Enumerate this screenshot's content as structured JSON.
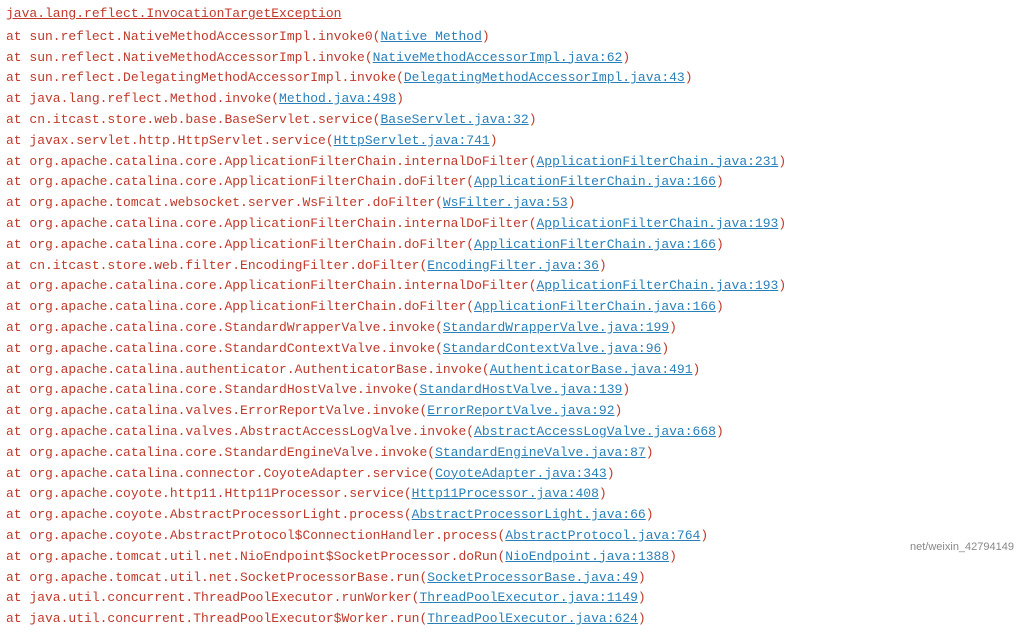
{
  "title": "java_lang_reflect_InvocationTargetException",
  "exception": {
    "name": "java.lang.reflect.InvocationTargetException"
  },
  "stack_lines": [
    {
      "prefix": "    at ",
      "method": "sun.reflect.NativeMethodAccessorImpl.invoke0(",
      "link_text": "Native Method",
      "link": "Native Method",
      "suffix": ")"
    },
    {
      "prefix": "    at ",
      "method": "sun.reflect.NativeMethodAccessorImpl.invoke(",
      "link_text": "NativeMethodAccessorImpl.java:62",
      "link": "NativeMethodAccessorImpl.java:62",
      "suffix": ")"
    },
    {
      "prefix": "    at ",
      "method": "sun.reflect.DelegatingMethodAccessorImpl.invoke(",
      "link_text": "DelegatingMethodAccessorImpl.java:43",
      "link": "DelegatingMethodAccessorImpl.java:43",
      "suffix": ")"
    },
    {
      "prefix": "    at ",
      "method": "java.lang.reflect.Method.invoke(",
      "link_text": "Method.java:498",
      "link": "Method.java:498",
      "suffix": ")"
    },
    {
      "prefix": "    at ",
      "method": "cn.itcast.store.web.base.BaseServlet.service(",
      "link_text": "BaseServlet.java:32",
      "link": "BaseServlet.java:32",
      "suffix": ")"
    },
    {
      "prefix": "    at ",
      "method": "javax.servlet.http.HttpServlet.service(",
      "link_text": "HttpServlet.java:741",
      "link": "HttpServlet.java:741",
      "suffix": ")"
    },
    {
      "prefix": "    at ",
      "method": "org.apache.catalina.core.ApplicationFilterChain.internalDoFilter(",
      "link_text": "ApplicationFilterChain.java:231",
      "link": "ApplicationFilterChain.java:231",
      "suffix": ")"
    },
    {
      "prefix": "    at ",
      "method": "org.apache.catalina.core.ApplicationFilterChain.doFilter(",
      "link_text": "ApplicationFilterChain.java:166",
      "link": "ApplicationFilterChain.java:166",
      "suffix": ")"
    },
    {
      "prefix": "    at ",
      "method": "org.apache.tomcat.websocket.server.WsFilter.doFilter(",
      "link_text": "WsFilter.java:53",
      "link": "WsFilter.java:53",
      "suffix": ")"
    },
    {
      "prefix": "    at ",
      "method": "org.apache.catalina.core.ApplicationFilterChain.internalDoFilter(",
      "link_text": "ApplicationFilterChain.java:193",
      "link": "ApplicationFilterChain.java:193",
      "suffix": ")"
    },
    {
      "prefix": "    at ",
      "method": "org.apache.catalina.core.ApplicationFilterChain.doFilter(",
      "link_text": "ApplicationFilterChain.java:166",
      "link": "ApplicationFilterChain.java:166",
      "suffix": ")"
    },
    {
      "prefix": "    at ",
      "method": "cn.itcast.store.web.filter.EncodingFilter.doFilter(",
      "link_text": "EncodingFilter.java:36",
      "link": "EncodingFilter.java:36",
      "suffix": ")"
    },
    {
      "prefix": "    at ",
      "method": "org.apache.catalina.core.ApplicationFilterChain.internalDoFilter(",
      "link_text": "ApplicationFilterChain.java:193",
      "link": "ApplicationFilterChain.java:193",
      "suffix": ")"
    },
    {
      "prefix": "    at ",
      "method": "org.apache.catalina.core.ApplicationFilterChain.doFilter(",
      "link_text": "ApplicationFilterChain.java:166",
      "link": "ApplicationFilterChain.java:166",
      "suffix": ")"
    },
    {
      "prefix": "    at ",
      "method": "org.apache.catalina.core.StandardWrapperValve.invoke(",
      "link_text": "StandardWrapperValve.java:199",
      "link": "StandardWrapperValve.java:199",
      "suffix": ")"
    },
    {
      "prefix": "    at ",
      "method": "org.apache.catalina.core.StandardContextValve.invoke(",
      "link_text": "StandardContextValve.java:96",
      "link": "StandardContextValve.java:96",
      "suffix": ")"
    },
    {
      "prefix": "    at ",
      "method": "org.apache.catalina.authenticator.AuthenticatorBase.invoke(",
      "link_text": "AuthenticatorBase.java:491",
      "link": "AuthenticatorBase.java:491",
      "suffix": ")"
    },
    {
      "prefix": "    at ",
      "method": "org.apache.catalina.core.StandardHostValve.invoke(",
      "link_text": "StandardHostValve.java:139",
      "link": "StandardHostValve.java:139",
      "suffix": ")"
    },
    {
      "prefix": "    at ",
      "method": "org.apache.catalina.valves.ErrorReportValve.invoke(",
      "link_text": "ErrorReportValve.java:92",
      "link": "ErrorReportValve.java:92",
      "suffix": ")"
    },
    {
      "prefix": "    at ",
      "method": "org.apache.catalina.valves.AbstractAccessLogValve.invoke(",
      "link_text": "AbstractAccessLogValve.java:668",
      "link": "AbstractAccessLogValve.java:668",
      "suffix": ")"
    },
    {
      "prefix": "    at ",
      "method": "org.apache.catalina.core.StandardEngineValve.invoke(",
      "link_text": "StandardEngineValve.java:87",
      "link": "StandardEngineValve.java:87",
      "suffix": ")"
    },
    {
      "prefix": "    at ",
      "method": "org.apache.catalina.connector.CoyoteAdapter.service(",
      "link_text": "CoyoteAdapter.java:343",
      "link": "CoyoteAdapter.java:343",
      "suffix": ")"
    },
    {
      "prefix": "    at ",
      "method": "org.apache.coyote.http11.Http11Processor.service(",
      "link_text": "Http11Processor.java:408",
      "link": "Http11Processor.java:408",
      "suffix": ")"
    },
    {
      "prefix": "    at ",
      "method": "org.apache.coyote.AbstractProcessorLight.process(",
      "link_text": "AbstractProcessorLight.java:66",
      "link": "AbstractProcessorLight.java:66",
      "suffix": ")"
    },
    {
      "prefix": "    at ",
      "method": "org.apache.coyote.AbstractProtocol$ConnectionHandler.process(",
      "link_text": "AbstractProtocol.java:764",
      "link": "AbstractProtocol.java:764",
      "suffix": ")"
    },
    {
      "prefix": "    at ",
      "method": "org.apache.tomcat.util.net.NioEndpoint$SocketProcessor.doRun(",
      "link_text": "NioEndpoint.java:1388",
      "link": "NioEndpoint.java:1388",
      "suffix": ")"
    },
    {
      "prefix": "    at ",
      "method": "org.apache.tomcat.util.net.SocketProcessorBase.run(",
      "link_text": "SocketProcessorBase.java:49",
      "link": "SocketProcessorBase.java:49",
      "suffix": ")"
    },
    {
      "prefix": "    at ",
      "method": "java.util.concurrent.ThreadPoolExecutor.runWorker(",
      "link_text": "ThreadPoolExecutor.java:1149",
      "link": "ThreadPoolExecutor.java:1149",
      "suffix": ")"
    },
    {
      "prefix": "    at ",
      "method": "java.util.concurrent.ThreadPoolExecutor$Worker.run(",
      "link_text": "ThreadPoolExecutor.java:624",
      "link": "ThreadPoolExecutor.java:624",
      "suffix": ")"
    }
  ],
  "watermark": "net/weixin_42794149"
}
